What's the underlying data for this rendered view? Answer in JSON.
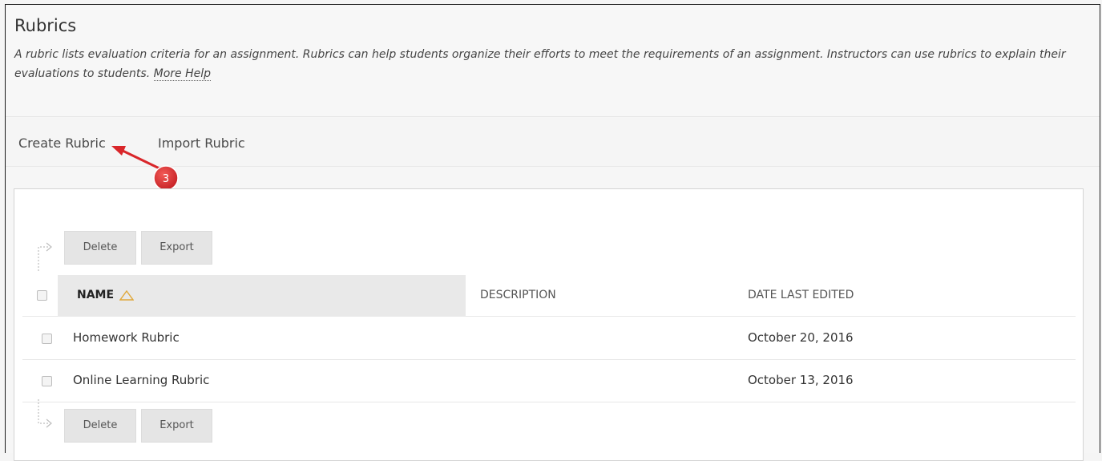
{
  "page": {
    "title": "Rubrics",
    "description": "A rubric lists evaluation criteria for an assignment. Rubrics can help students organize their efforts to meet the requirements of an assignment. Instructors can use rubrics to explain their evaluations to students.",
    "help_link": "More Help"
  },
  "actions": {
    "create": "Create Rubric",
    "import": "Import Rubric"
  },
  "annotation": {
    "step_number": "3",
    "color": "#d9262a"
  },
  "toolbar": {
    "delete_label": "Delete",
    "export_label": "Export"
  },
  "table": {
    "columns": {
      "name": "NAME",
      "description": "DESCRIPTION",
      "date": "DATE LAST EDITED"
    },
    "sort": {
      "column": "name",
      "direction": "ascending",
      "icon": "sort-ascending-triangle-icon"
    },
    "rows": [
      {
        "name": "Homework Rubric",
        "description": "",
        "date": "October 20, 2016"
      },
      {
        "name": "Online Learning Rubric",
        "description": "",
        "date": "October 13, 2016"
      }
    ]
  }
}
